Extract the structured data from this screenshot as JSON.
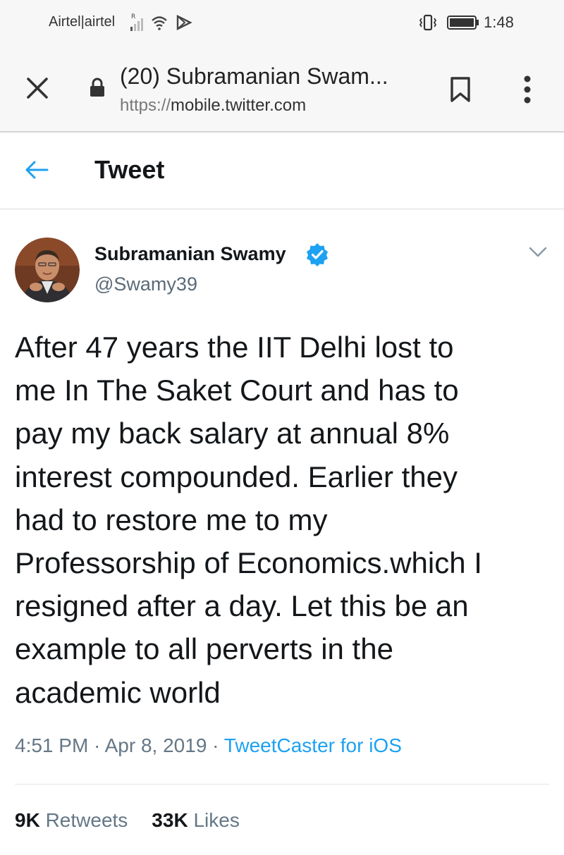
{
  "status_bar": {
    "carrier": "Airtel|airtel",
    "time": "1:48",
    "icons": [
      "signal-icon",
      "wifi-icon",
      "play-store-icon",
      "vibrate-icon",
      "battery-icon"
    ]
  },
  "browser": {
    "page_title": "(20) Subramanian Swam...",
    "url_scheme": "https://",
    "url_host": "mobile.twitter.com",
    "icons": [
      "close-icon",
      "lock-icon",
      "bookmark-icon",
      "overflow-menu-icon"
    ]
  },
  "header": {
    "title": "Tweet",
    "back_icon": "arrow-left-icon"
  },
  "tweet": {
    "author_name": "Subramanian Swamy",
    "author_handle": "@Swamy39",
    "verified": true,
    "text_lines": [
      "After 47 years the IIT Delhi lost to",
      "me In The Saket Court and has to",
      "pay my back salary at annual 8%",
      "interest compounded. Earlier they",
      "had to restore me to my",
      "Professorship of Economics.which I",
      "resigned after a day. Let this be an",
      "example to all perverts in the",
      "academic world"
    ],
    "time": "4:51 PM",
    "date": "Apr 8, 2019",
    "separator": " · ",
    "source": "TweetCaster for iOS",
    "retweets_count": "9K",
    "retweets_label": "Retweets",
    "likes_count": "33K",
    "likes_label": "Likes"
  },
  "colors": {
    "accent": "#1da1f2",
    "text_primary": "#14171a",
    "text_secondary": "#657786",
    "chrome_bg": "#f7f7f7"
  }
}
